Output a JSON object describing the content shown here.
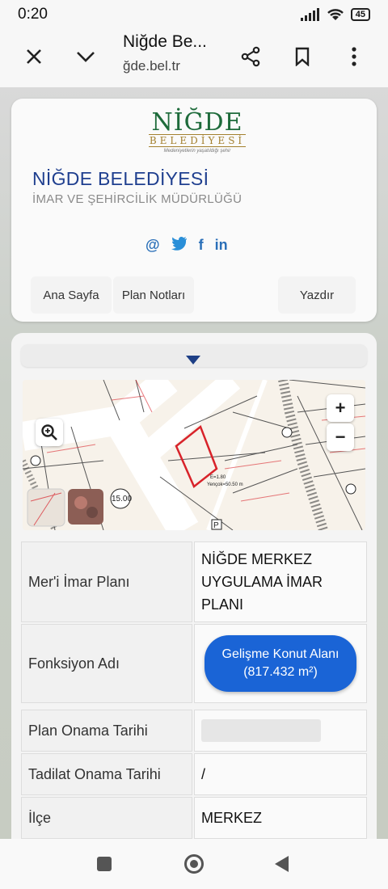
{
  "status_bar": {
    "time": "0:20",
    "battery": "45"
  },
  "browser": {
    "title": "Niğde Be...",
    "url": "ğde.bel.tr",
    "icons": [
      "close-icon",
      "chevron-down-icon",
      "share-icon",
      "bookmark-icon",
      "more-vert-icon"
    ]
  },
  "header": {
    "logo_main": "NİĞDE",
    "logo_sub": "BELEDİYESİ",
    "logo_slogan": "Medeniyetlerin yaşatıldığı şehir",
    "org_title": "NİĞDE BELEDİYESİ",
    "org_subtitle": "İMAR VE ŞEHİRCİLİK MÜDÜRLÜĞÜ",
    "socials": [
      {
        "icon": "email-icon",
        "glyph": "@"
      },
      {
        "icon": "twitter-icon",
        "glyph": "🐦"
      },
      {
        "icon": "facebook-icon",
        "glyph": "f"
      },
      {
        "icon": "linkedin-icon",
        "glyph": "in"
      }
    ],
    "nav": {
      "home": "Ana Sayfa",
      "plan_notes": "Plan Notları",
      "print": "Yazdır"
    }
  },
  "map": {
    "zoom_in": "+",
    "zoom_out": "−",
    "label_15": "15.00",
    "label_e": "E=1.80",
    "label_yencok": "Yençok=50.50 m",
    "label_p": "P"
  },
  "table": {
    "rows": [
      {
        "label": "Mer'i İmar Planı",
        "value": "NİĞDE MERKEZ UYGULAMA İMAR PLANI"
      },
      {
        "label": "Fonksiyon Adı",
        "value": "Gelişme Konut Alanı (817.432 m²)"
      },
      {
        "label": "Plan Onama Tarihi",
        "value": ""
      },
      {
        "label": "Tadilat Onama Tarihi",
        "value": "/"
      },
      {
        "label": "İlçe",
        "value": "MERKEZ"
      }
    ]
  },
  "colors": {
    "brand_green": "#1e6b3b",
    "title_blue": "#1f3f8f",
    "pill_blue": "#1a64d6",
    "parcel_red": "#d8232a"
  }
}
